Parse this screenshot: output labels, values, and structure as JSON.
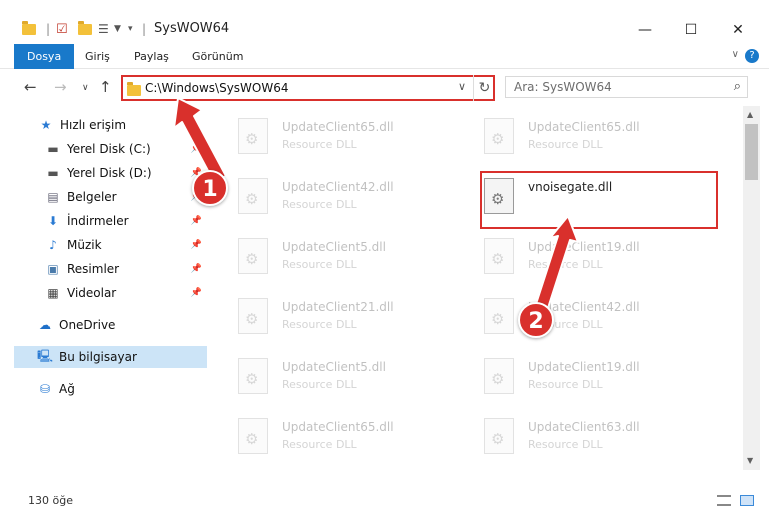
{
  "window": {
    "title": "SysWOW64",
    "minimize_glyph": "—",
    "maximize_glyph": "☐",
    "close_glyph": "✕"
  },
  "ribbon": {
    "tabs": [
      "Dosya",
      "Giriş",
      "Paylaş",
      "Görünüm"
    ],
    "help_glyph": "?"
  },
  "nav": {
    "address": "C:\\Windows\\SysWOW64",
    "search_placeholder": "Ara: SysWOW64"
  },
  "sidebar": {
    "items": [
      {
        "label": "Hızlı erişim",
        "icon": "star-icon"
      },
      {
        "label": "Yerel Disk (C:)",
        "icon": "drive-icon"
      },
      {
        "label": "Yerel Disk (D:)",
        "icon": "drive-icon"
      },
      {
        "label": "Belgeler",
        "icon": "documents-icon"
      },
      {
        "label": "İndirmeler",
        "icon": "download-icon"
      },
      {
        "label": "Müzik",
        "icon": "music-icon"
      },
      {
        "label": "Resimler",
        "icon": "pictures-icon"
      },
      {
        "label": "Videolar",
        "icon": "video-icon"
      },
      {
        "label": "OneDrive",
        "icon": "cloud-icon"
      },
      {
        "label": "Bu bilgisayar",
        "icon": "computer-icon"
      },
      {
        "label": "Ağ",
        "icon": "network-icon"
      }
    ]
  },
  "files": [
    {
      "name": "UpdateClient65.dll",
      "type": "Resource DLL"
    },
    {
      "name": "UpdateClient65.dll",
      "type": "Resource DLL"
    },
    {
      "name": "UpdateClient42.dll",
      "type": "Resource DLL"
    },
    {
      "name": "vnoisegate.dll",
      "type": ""
    },
    {
      "name": "UpdateClient5.dll",
      "type": "Resource DLL"
    },
    {
      "name": "UpdateClient19.dll",
      "type": "Resource DLL"
    },
    {
      "name": "UpdateClient21.dll",
      "type": "Resource DLL"
    },
    {
      "name": "UpdateClient42.dll",
      "type": "Resource DLL"
    },
    {
      "name": "UpdateClient5.dll",
      "type": "Resource DLL"
    },
    {
      "name": "UpdateClient19.dll",
      "type": "Resource DLL"
    },
    {
      "name": "UpdateClient65.dll",
      "type": "Resource DLL"
    },
    {
      "name": "UpdateClient63.dll",
      "type": "Resource DLL"
    }
  ],
  "status": {
    "item_count": "130 öğe"
  },
  "annotations": {
    "step1": "1",
    "step2": "2",
    "accent_color": "#d9302c"
  },
  "colors": {
    "selected_tab": "#1979ca",
    "sidebar_selected": "#cce4f7"
  }
}
